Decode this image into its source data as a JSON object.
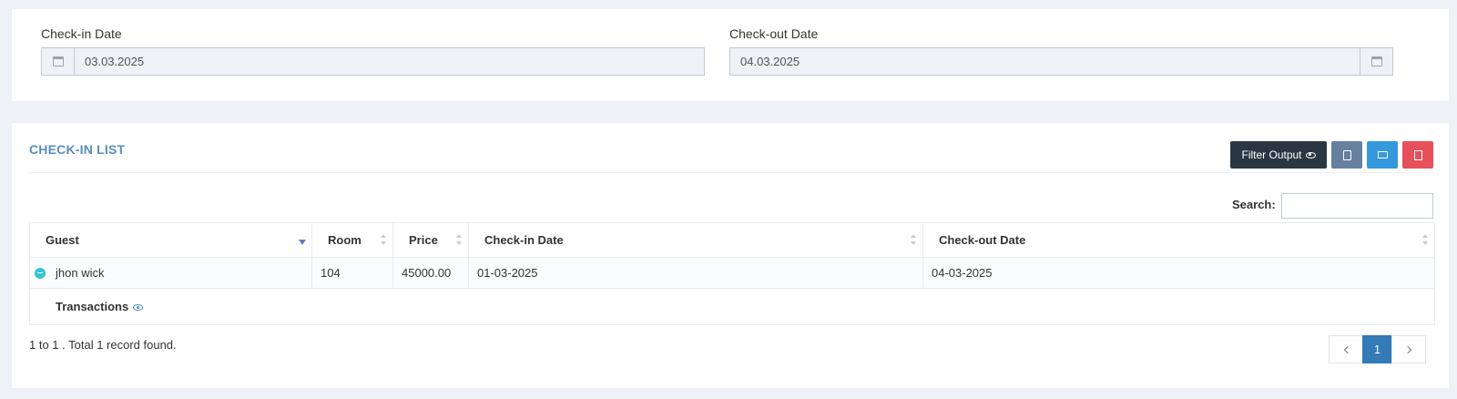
{
  "filters": {
    "checkin": {
      "label": "Check-in Date",
      "value": "03.03.2025",
      "icon": "calendar-icon"
    },
    "checkout": {
      "label": "Check-out Date",
      "value": "04.03.2025",
      "icon": "calendar-icon"
    }
  },
  "list": {
    "title": "CHECK-IN LIST",
    "buttons": {
      "filter_label": "Filter Output",
      "excel_icon": "file-excel-icon",
      "print_icon": "printer-icon",
      "pdf_icon": "file-pdf-icon"
    },
    "search": {
      "label": "Search:",
      "value": ""
    },
    "columns": [
      "Guest",
      "Room",
      "Price",
      "Check-in Date",
      "Check-out Date"
    ],
    "rows": [
      {
        "guest": "jhon wick",
        "room": "104",
        "price": "45000.00",
        "checkin": "01-03-2025",
        "checkout": "04-03-2025"
      }
    ],
    "child_row": {
      "label": "Transactions"
    },
    "info": "1 to 1 . Total 1 record found.",
    "pagination": {
      "current": "1"
    }
  },
  "colors": {
    "background": "#eef1f5",
    "title_blue": "#578ebe",
    "filter_button": "#2b3643",
    "excel_button": "#67809f",
    "print_button": "#3598dc",
    "pdf_button": "#e7505a",
    "page_active": "#337ab7"
  }
}
